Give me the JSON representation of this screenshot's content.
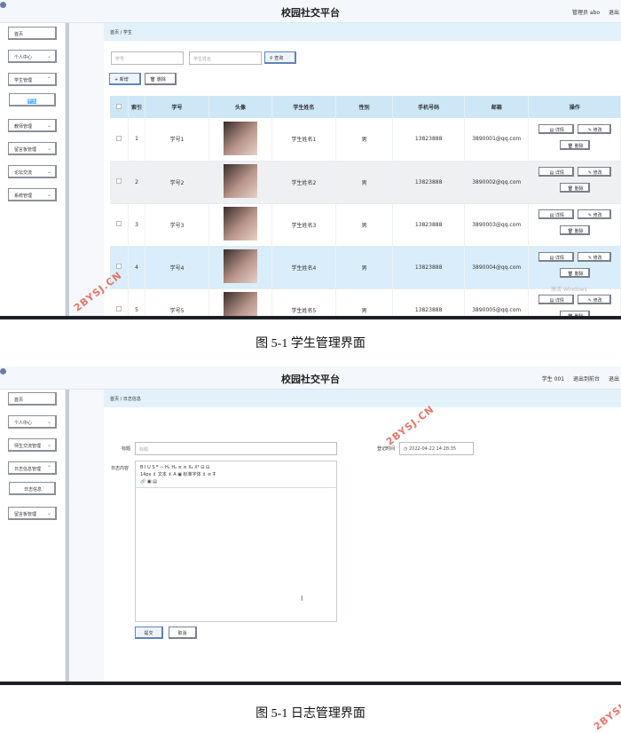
{
  "shot1": {
    "app_title": "校园社交平台",
    "header_right": [
      "管理员 abo",
      "退出"
    ],
    "sidebar": [
      "首页",
      "个人中心",
      "学生管理",
      "学生",
      "教师管理",
      "留言板管理",
      "论坛交流",
      "系统管理"
    ],
    "breadcrumb": "首页 / 学生",
    "search": {
      "student_no_placeholder": "学号",
      "student_name_placeholder": "学生姓名",
      "query_label": "查询"
    },
    "actions": {
      "add_label": "+ 新增",
      "delete_label": "删除"
    },
    "table": {
      "headers": [
        "索引",
        "学号",
        "头像",
        "学生姓名",
        "性别",
        "手机号码",
        "邮箱",
        "操作"
      ],
      "rows": [
        {
          "index": "1",
          "student_no": "学号1",
          "name": "学生姓名1",
          "gender": "男",
          "phone": "13823888",
          "email": "3890001@qq.com"
        },
        {
          "index": "2",
          "student_no": "学号2",
          "name": "学生姓名2",
          "gender": "男",
          "phone": "13823888",
          "email": "3890002@qq.com"
        },
        {
          "index": "3",
          "student_no": "学号3",
          "name": "学生姓名3",
          "gender": "男",
          "phone": "13823888",
          "email": "3890003@qq.com"
        },
        {
          "index": "4",
          "student_no": "学号4",
          "name": "学生姓名4",
          "gender": "男",
          "phone": "13823888",
          "email": "3890004@qq.com"
        },
        {
          "index": "5",
          "student_no": "学号5",
          "name": "学生姓名5",
          "gender": "男",
          "phone": "13823888",
          "email": "3890005@qq.com"
        }
      ],
      "op_labels": {
        "detail": "详情",
        "edit": "修改",
        "delete": "删除"
      }
    },
    "activate_text": "激活 Windows"
  },
  "caption1": "图 5-1  学生管理界面",
  "shot2": {
    "app_title": "校园社交平台",
    "header_right": [
      "学生 001",
      "退出到前台",
      "退出"
    ],
    "sidebar": [
      "首页",
      "个人中心",
      "师生交流管理",
      "日志信息管理",
      "日志信息",
      "留言板管理"
    ],
    "breadcrumb": "首页 / 日志信息",
    "form": {
      "title_label": "标题",
      "title_placeholder": "标题",
      "time_label": "登记时间",
      "time_value": "2022-04-22 14:28:35",
      "content_label": "日志内容",
      "toolbar_row1": "B  I  U  S    ❞  ‹›    H₁  H₂    ≡  ≡    X₂  X²    ⊟  ⊟",
      "toolbar_row2": "14px  ⇕    文本  ⇕    A  ▣    标准字体  ⇕    ≡    T̶",
      "toolbar_row3": "🔗  ▣  ▤",
      "submit_label": "提交",
      "cancel_label": "取消"
    }
  },
  "caption2": "图 5-1  日志管理界面",
  "watermark": "2BYSJ.CN"
}
